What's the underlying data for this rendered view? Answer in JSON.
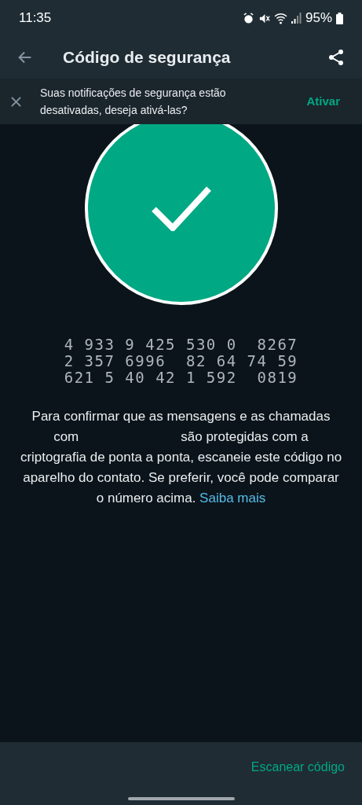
{
  "status_bar": {
    "time": "11:35",
    "battery": "95%"
  },
  "header": {
    "title": "Código de segurança"
  },
  "banner": {
    "message": "Suas notificações de segurança estão desativadas, deseja ativá-las?",
    "action": "Ativar"
  },
  "verified": true,
  "code_rows": [
    "4 933 9 425 530 0  8267",
    "2 357 6996  82 64 74 59",
    "621 5 40 42 1 592  0819"
  ],
  "description": {
    "before": "Para confirmar que as mensagens e as chamadas com",
    "after": "são protegidas com a criptografia de ponta a ponta, escaneie este código no aparelho do contato. Se preferir, você pode comparar o número acima.",
    "link": "Saiba mais"
  },
  "bottom_action": "Escanear código"
}
